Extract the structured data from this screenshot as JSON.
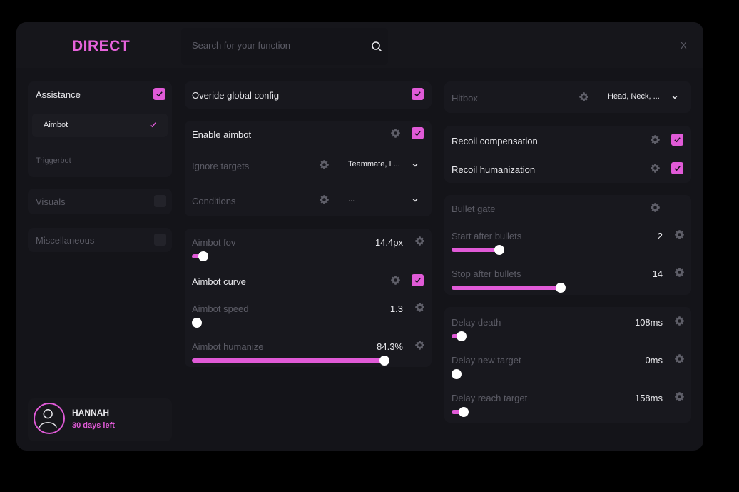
{
  "brand": "DIRECT",
  "search": {
    "placeholder": "Search for your function",
    "value": ""
  },
  "close_label": "X",
  "sidebar": {
    "categories": [
      {
        "label": "Assistance",
        "checked": true,
        "items": [
          {
            "label": "Aimbot",
            "active": true
          },
          {
            "label": "Triggerbot",
            "active": false
          }
        ]
      },
      {
        "label": "Visuals",
        "checked": false
      },
      {
        "label": "Miscellaneous",
        "checked": false
      }
    ],
    "user": {
      "name": "HANNAH",
      "subscription": "30 days left"
    }
  },
  "middle": {
    "override_label": "Overide global config",
    "override_checked": true,
    "enable_label": "Enable aimbot",
    "enable_checked": true,
    "ignore_label": "Ignore targets",
    "ignore_value": "Teammate, I ...",
    "conditions_label": "Conditions",
    "conditions_value": "...",
    "fov_label": "Aimbot fov",
    "fov_value": "14.4px",
    "fov_fraction": 0.06,
    "curve_label": "Aimbot curve",
    "curve_checked": true,
    "speed_label": "Aimbot speed",
    "speed_value": "1.3",
    "speed_fraction": 0.0,
    "humanize_label": "Aimbot humanize",
    "humanize_value": "84.3%",
    "humanize_fraction": 0.843
  },
  "right": {
    "hitbox_label": "Hitbox",
    "hitbox_value": "Head, Neck, ...",
    "recoil_comp_label": "Recoil compensation",
    "recoil_comp_checked": true,
    "recoil_human_label": "Recoil humanization",
    "recoil_human_checked": true,
    "bullet_gate_label": "Bullet gate",
    "start_label": "Start after bullets",
    "start_value": "2",
    "start_fraction": 0.44,
    "stop_label": "Stop after bullets",
    "stop_value": "14",
    "stop_fraction": 1.0,
    "delay_death_label": "Delay death",
    "delay_death_value": "108ms",
    "delay_death_fraction": 0.09,
    "delay_new_label": "Delay new target",
    "delay_new_value": "0ms",
    "delay_new_fraction": 0.0,
    "delay_reach_label": "Delay reach target",
    "delay_reach_value": "158ms",
    "delay_reach_fraction": 0.11
  },
  "colors": {
    "accent": "#e05ad7",
    "brand": "#e763dc",
    "background": "#141419"
  }
}
